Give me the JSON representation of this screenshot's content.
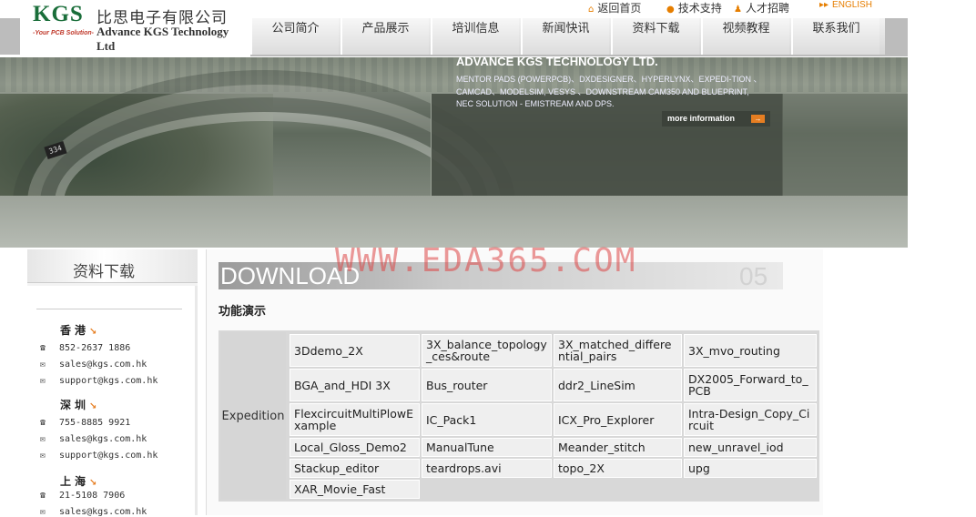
{
  "logo": {
    "brand": "KGS",
    "chinese_name": "比思电子有限公司",
    "slogan": "-Your PCB Solution-",
    "english_name": "Advance KGS Technology Ltd"
  },
  "toplinks": [
    {
      "label": "返回首页",
      "icon": "home-icon"
    },
    {
      "label": "技术支持",
      "icon": "drop-icon"
    },
    {
      "label": "人才招聘",
      "icon": "person-icon"
    },
    {
      "label": "ENGLISH",
      "icon": "arrow-right-icon"
    }
  ],
  "nav": [
    "公司简介",
    "产品展示",
    "培训信息",
    "新闻快讯",
    "资料下载",
    "视频教程",
    "联系我们"
  ],
  "banner": {
    "title": "ADVANCE KGS TECHNOLOGY LTD.",
    "text": "MENTOR PADS (POWERPCB)、DXDESIGNER、HYPERLYNX、EXPEDI-TION 、CAMCAD、MODELSIM, VESYS 、DOWNSTREAM  CAM350 AND BLUEPRINT, NEC SOLUTION - EMISTREAM AND DPS.",
    "more": "more information",
    "chip_label": "334"
  },
  "sidebar": {
    "title": "资料下载",
    "offices": [
      {
        "city": "香港",
        "phone": "852-2637 1886",
        "emails": [
          "sales@kgs.com.hk",
          "support@kgs.com.hk"
        ]
      },
      {
        "city": "深圳",
        "phone": "755-8885 9921",
        "emails": [
          "sales@kgs.com.hk",
          "support@kgs.com.hk"
        ]
      },
      {
        "city": "上海",
        "phone": "21-5108 7906",
        "emails": [
          "sales@kgs.com.hk"
        ]
      }
    ]
  },
  "main": {
    "download_word": "DOWNLOAD",
    "section_number": "05",
    "watermark": "WWW.EDA365.COM",
    "section_title": "功能演示",
    "category": "Expedition",
    "rows": [
      [
        "3Ddemo_2X",
        "3X_balance_topology_ces&route",
        "3X_matched_differential_pairs",
        "3X_mvo_routing"
      ],
      [
        "BGA_and_HDI 3X",
        "Bus_router",
        "ddr2_LineSim",
        "DX2005_Forward_to_PCB"
      ],
      [
        "FlexcircuitMultiPlowExample",
        "IC_Pack1",
        "ICX_Pro_Explorer",
        "Intra-Design_Copy_Circuit"
      ],
      [
        "Local_Gloss_Demo2",
        "ManualTune",
        "Meander_stitch",
        "new_unravel_iod"
      ],
      [
        "Stackup_editor",
        "teardrops.avi",
        "topo_2X",
        "upg"
      ],
      [
        "XAR_Movie_Fast"
      ]
    ]
  },
  "colors": {
    "brand_green": "#1a6e3a",
    "accent_orange": "#e67e22",
    "watermark_red": "#dc4646"
  }
}
